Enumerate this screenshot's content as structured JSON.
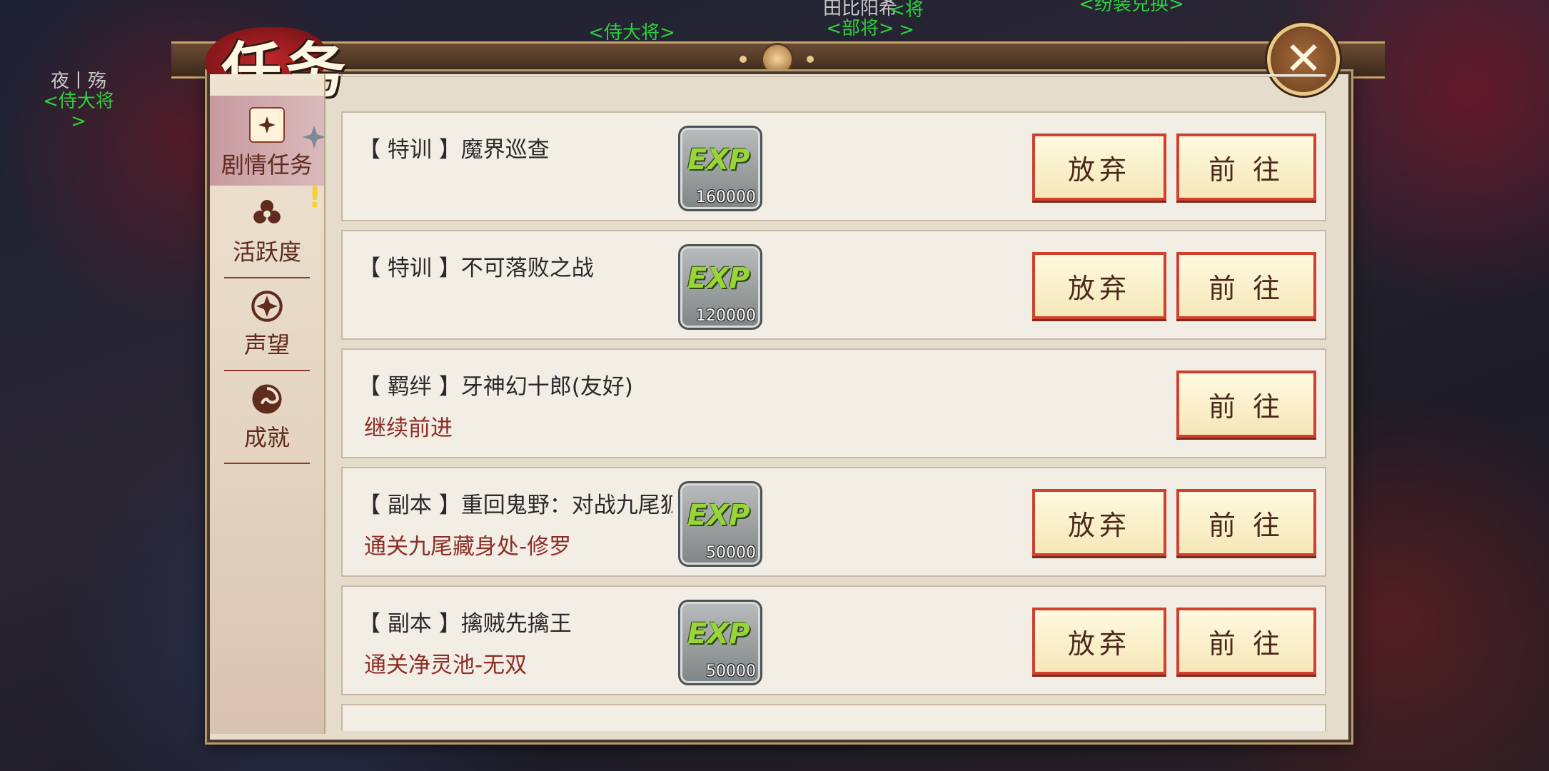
{
  "background_labels": [
    {
      "name": "夜丨殇",
      "rank": "<侍大将>"
    },
    {
      "name": "",
      "rank": "<侍大将>"
    },
    {
      "name": "田比阳希",
      "rank": "<部将>"
    },
    {
      "name": "",
      "rank": "<将>"
    },
    {
      "name": "",
      "rank": "<纷装兑换>"
    }
  ],
  "header": {
    "title": "任务",
    "close_icon": "close-icon"
  },
  "sidebar": {
    "items": [
      {
        "label": "剧情任务",
        "icon": "scroll-icon",
        "active": true
      },
      {
        "label": "活跃度",
        "icon": "flower-icon"
      },
      {
        "label": "声望",
        "icon": "crest-icon"
      },
      {
        "label": "成就",
        "icon": "swirl-icon"
      }
    ],
    "notice_badge": "!"
  },
  "quests": [
    {
      "title": "【 特训 】魔界巡查",
      "subtitle": "",
      "exp_label": "EXP",
      "exp": "160000",
      "abandon": "放弃",
      "go": "前 往"
    },
    {
      "title": "【 特训 】不可落败之战",
      "subtitle": "",
      "exp_label": "EXP",
      "exp": "120000",
      "abandon": "放弃",
      "go": "前 往"
    },
    {
      "title": "【 羁绊 】牙神幻十郎(友好)",
      "subtitle": "继续前进",
      "exp_label": "",
      "exp": "",
      "abandon": "",
      "go": "前 往"
    },
    {
      "title": "【 副本 】重回鬼野：对战九尾狐",
      "subtitle": "通关九尾藏身处-修罗",
      "exp_label": "EXP",
      "exp": "50000",
      "abandon": "放弃",
      "go": "前 往"
    },
    {
      "title": "【 副本 】擒贼先擒王",
      "subtitle": "通关净灵池-无双",
      "exp_label": "EXP",
      "exp": "50000",
      "abandon": "放弃",
      "go": "前 往"
    }
  ],
  "colors": {
    "accent_red": "#d1402e",
    "subtitle_red": "#8c2e28",
    "rank_green": "#2fcf3e",
    "exp_green": "#9ad43a"
  }
}
